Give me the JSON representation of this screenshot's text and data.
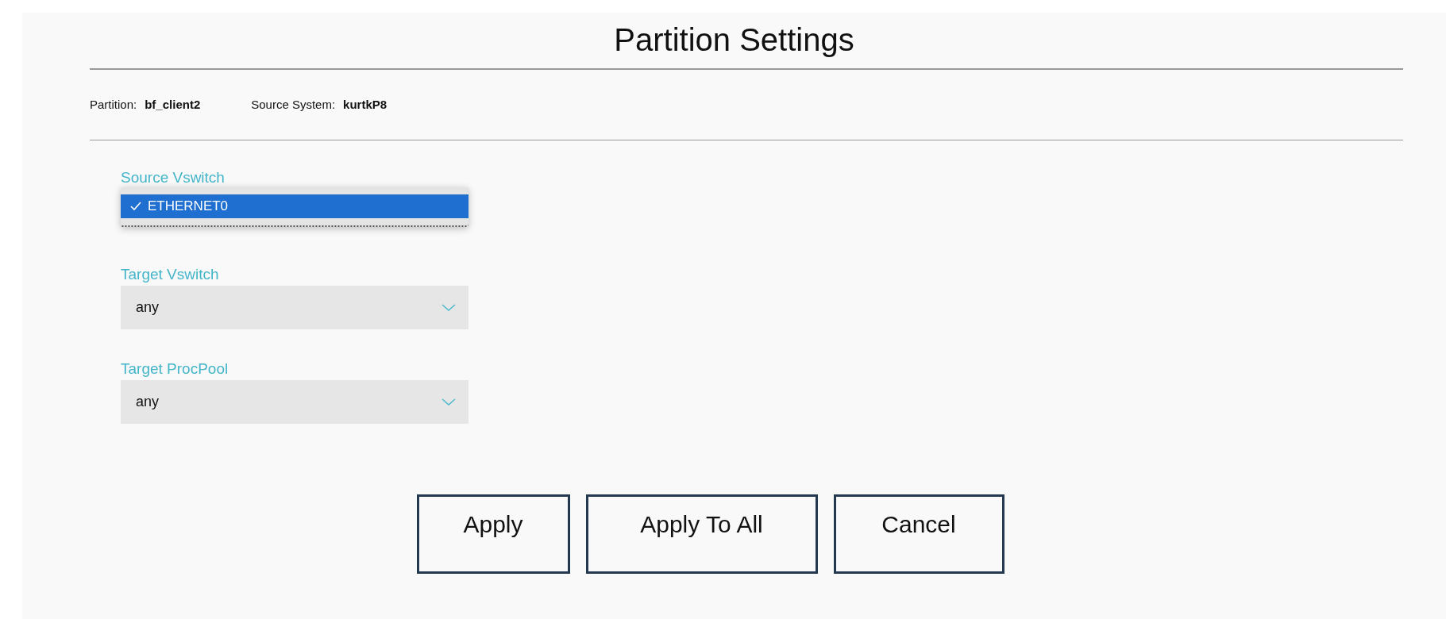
{
  "title": "Partition Settings",
  "info": [
    {
      "label": "Partition:",
      "value": "bf_client2"
    },
    {
      "label": "Source System:",
      "value": "kurtkP8"
    }
  ],
  "fields": [
    {
      "kind": "open-list",
      "label": "Source Vswitch",
      "options": [
        {
          "label": "ETHERNET0",
          "selected": true
        }
      ]
    },
    {
      "kind": "select",
      "label": "Target Vswitch",
      "value": "any"
    },
    {
      "kind": "select",
      "label": "Target ProcPool",
      "value": "any"
    }
  ],
  "buttons": [
    "Apply",
    "Apply To All",
    "Cancel"
  ]
}
